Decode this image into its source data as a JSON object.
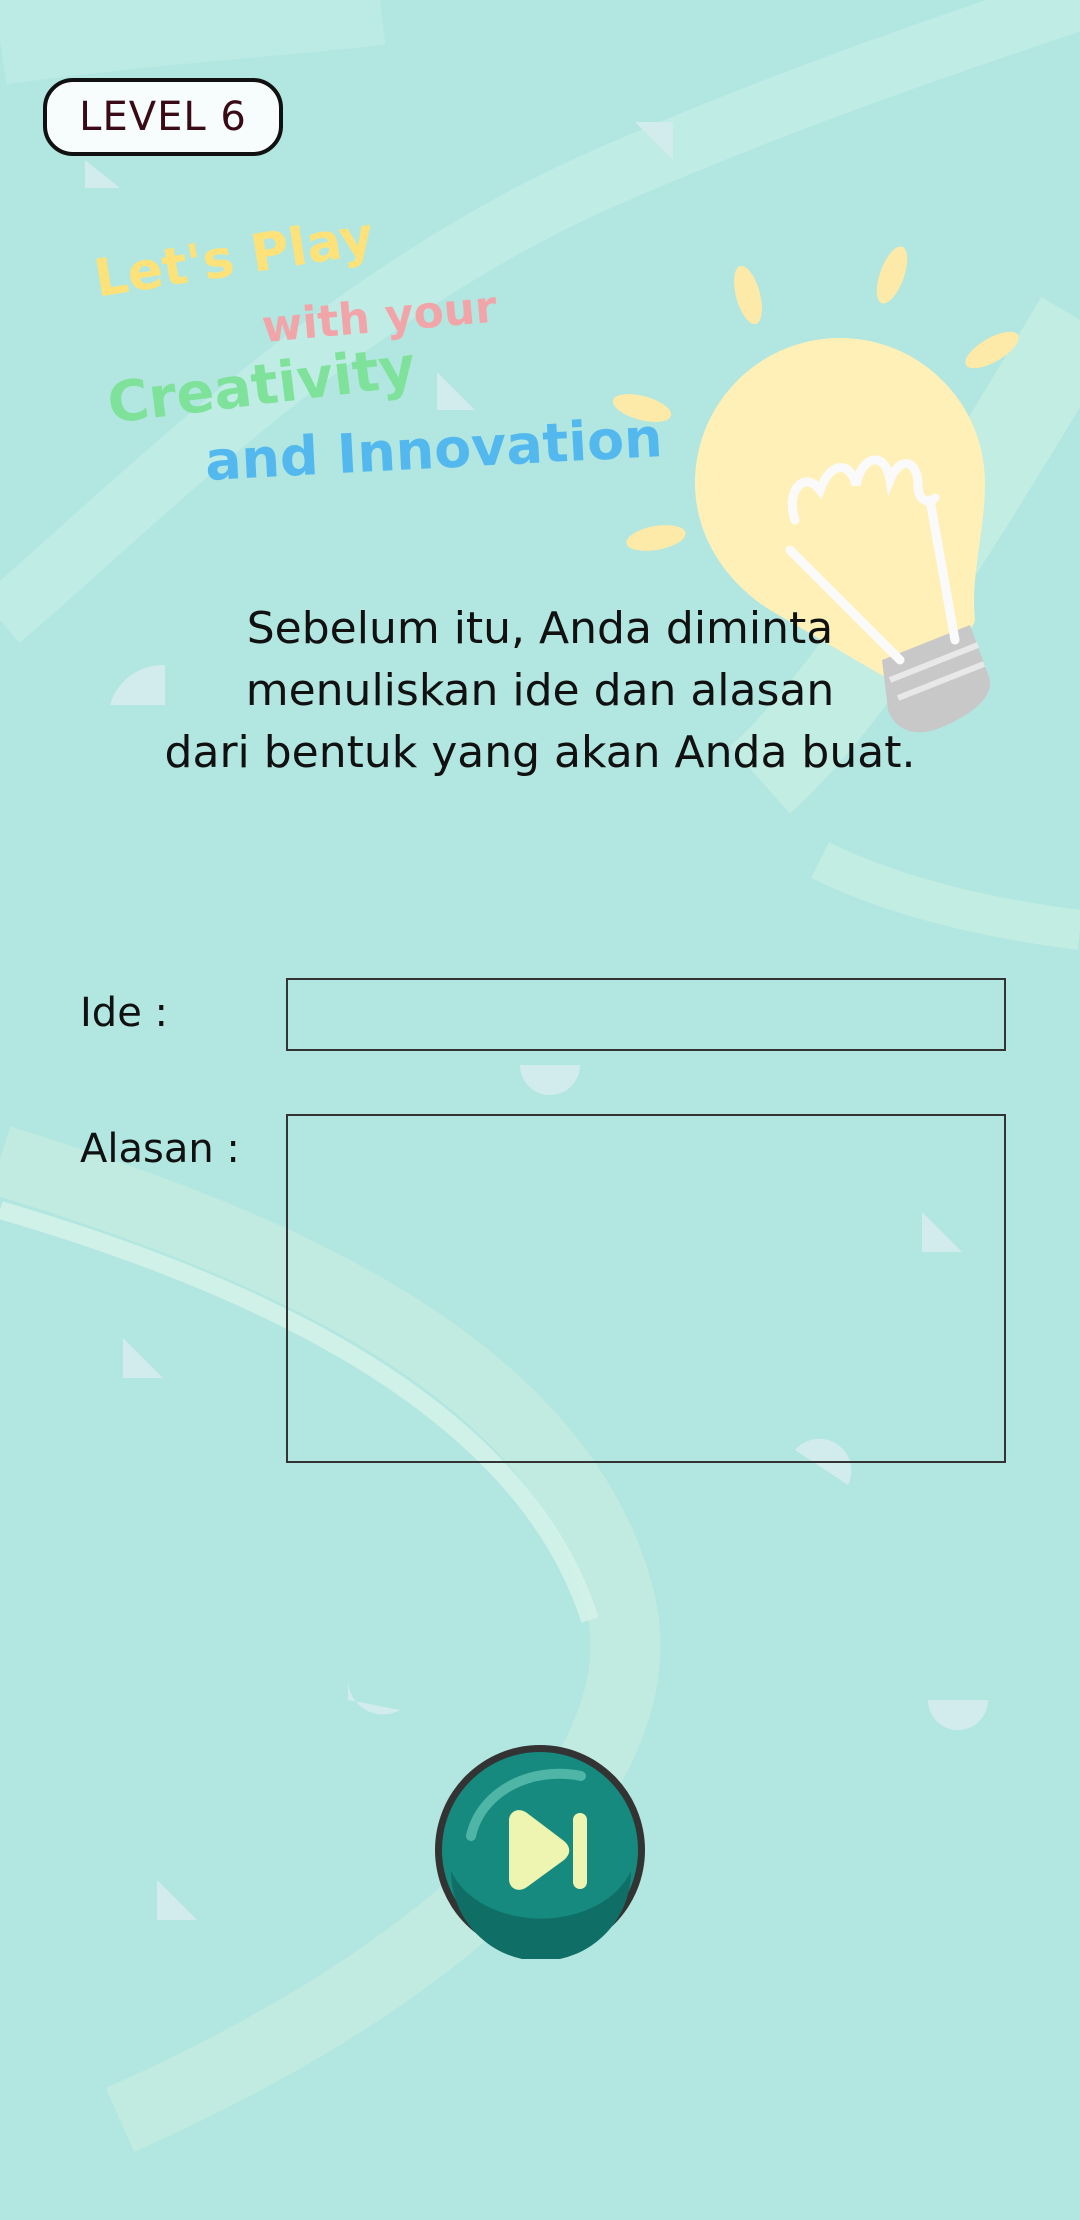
{
  "level": {
    "label": "LEVEL 6"
  },
  "tagline": {
    "line1": "Let's Play",
    "line2": "with your",
    "line3": "Creativity",
    "line4": "and Innovation"
  },
  "instruction": {
    "line1": "Sebelum itu, Anda diminta",
    "line2": "menuliskan ide dan alasan",
    "line3": "dari bentuk yang akan Anda buat."
  },
  "form": {
    "idea_label": "Ide  :",
    "idea_value": "",
    "reason_label": "Alasan  :",
    "reason_value": ""
  },
  "next_button": {
    "icon": "play-next-icon"
  },
  "colors": {
    "background": "#b2e6e0",
    "button": "#168a7e",
    "bulb": "#fff0b8"
  }
}
